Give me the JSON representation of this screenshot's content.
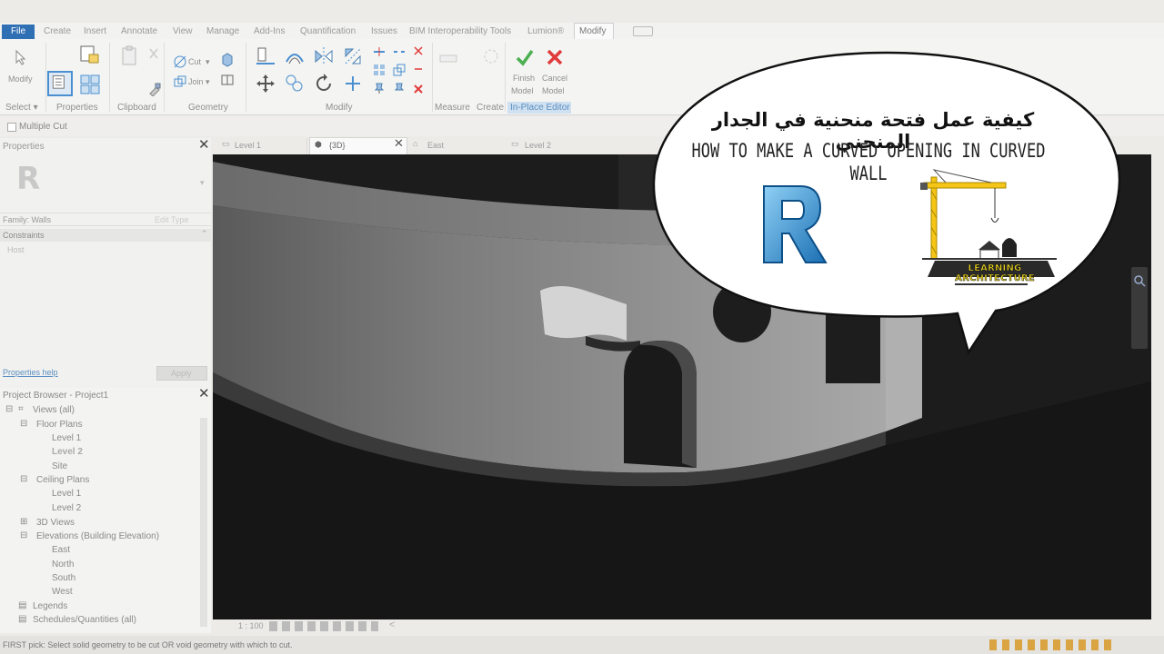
{
  "menubar": {
    "file": "File",
    "tabs": [
      "Create",
      "Insert",
      "Annotate",
      "View",
      "Manage",
      "Add-Ins",
      "Quantification",
      "Issues",
      "BIM Interoperability Tools",
      "Lumion®",
      "Modify"
    ]
  },
  "ribbon": {
    "modify_label": "Modify",
    "select_label": "Select ▾",
    "properties_label": "Properties",
    "clipboard_label": "Clipboard",
    "geometry_label": "Geometry",
    "modify_group_label": "Modify",
    "measure_label": "Measure",
    "create_label": "Create",
    "inplace_label": "In-Place Editor",
    "cut_label": "Cut",
    "join_label": "Join",
    "finish_label": "Finish\nModel",
    "cancel_label": "Cancel\nModel",
    "finish_line1": "Finish",
    "finish_line2": "Model",
    "cancel_line1": "Cancel",
    "cancel_line2": "Model",
    "multiple_cut": "Multiple Cut"
  },
  "properties": {
    "title": "Properties",
    "family": "Family: Walls",
    "edit_type": "Edit Type",
    "constraints": "Constraints",
    "host": "Host",
    "help_link": "Properties help",
    "apply": "Apply"
  },
  "browser": {
    "title": "Project Browser - Project1",
    "items": [
      {
        "label": "Views (all)"
      },
      {
        "label": "Floor Plans"
      },
      {
        "label": "Level 1"
      },
      {
        "label": "Level 2"
      },
      {
        "label": "Site"
      },
      {
        "label": "Ceiling Plans"
      },
      {
        "label": "Level 1"
      },
      {
        "label": "Level 2"
      },
      {
        "label": "3D Views"
      },
      {
        "label": "Elevations (Building Elevation)"
      },
      {
        "label": "East"
      },
      {
        "label": "North"
      },
      {
        "label": "South"
      },
      {
        "label": "West"
      },
      {
        "label": "Legends"
      },
      {
        "label": "Schedules/Quantities (all)"
      }
    ]
  },
  "view_tabs": [
    {
      "label": "Level 1"
    },
    {
      "label": "{3D}"
    },
    {
      "label": "East"
    },
    {
      "label": "Level 2"
    }
  ],
  "view_controls": {
    "scale": "1 : 100"
  },
  "status": {
    "text": "FIRST pick: Select solid geometry to be cut OR void geometry with which to cut."
  },
  "bubble": {
    "title_ar": "كيفية عمل فتحة منحنية في الجدار المنحني",
    "title_en": "HOW TO MAKE A CURVED OPENING IN CURVED WALL",
    "brand": "LEARNING ARCHITECTURE"
  },
  "colors": {
    "file_tab": "#2f6fb3",
    "revit_blue": "#2b8bd0",
    "crane_yellow": "#f5c518",
    "cancel_red": "#e03b3b",
    "finish_green": "#4caf50"
  }
}
